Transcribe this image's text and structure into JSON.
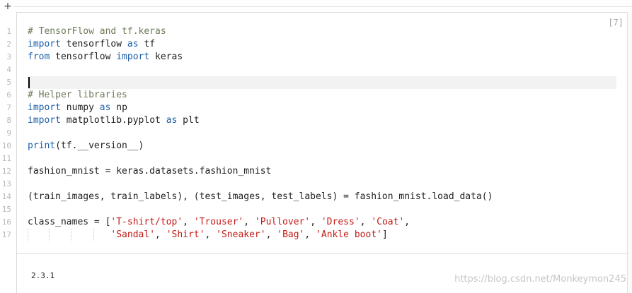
{
  "toolbar": {
    "add_cell_label": "+"
  },
  "cell": {
    "execution_count": "[7]",
    "line_numbers": [
      "1",
      "2",
      "3",
      "4",
      "5",
      "6",
      "7",
      "8",
      "9",
      "10",
      "11",
      "12",
      "13",
      "14",
      "15",
      "16",
      "17"
    ],
    "code_lines": [
      [
        {
          "t": "# TensorFlow and tf.keras",
          "c": "com"
        }
      ],
      [
        {
          "t": "import",
          "c": "kw"
        },
        {
          "t": " tensorflow "
        },
        {
          "t": "as",
          "c": "kw"
        },
        {
          "t": " tf"
        }
      ],
      [
        {
          "t": "from",
          "c": "kw"
        },
        {
          "t": " tensorflow "
        },
        {
          "t": "import",
          "c": "kw"
        },
        {
          "t": " keras"
        }
      ],
      [],
      [],
      [
        {
          "t": "# Helper libraries",
          "c": "com"
        }
      ],
      [
        {
          "t": "import",
          "c": "kw"
        },
        {
          "t": " numpy "
        },
        {
          "t": "as",
          "c": "kw"
        },
        {
          "t": " np"
        }
      ],
      [
        {
          "t": "import",
          "c": "kw"
        },
        {
          "t": " matplotlib.pyplot "
        },
        {
          "t": "as",
          "c": "kw"
        },
        {
          "t": " plt"
        }
      ],
      [],
      [
        {
          "t": "print",
          "c": "kw"
        },
        {
          "t": "(tf.__version__)"
        }
      ],
      [],
      [
        {
          "t": "fashion_mnist = keras.datasets.fashion_mnist"
        }
      ],
      [],
      [
        {
          "t": "(train_images, train_labels), (test_images, test_labels) = fashion_mnist.load_data()"
        }
      ],
      [],
      [
        {
          "t": "class_names = ["
        },
        {
          "t": "'T-shirt/top'",
          "c": "str"
        },
        {
          "t": ", "
        },
        {
          "t": "'Trouser'",
          "c": "str"
        },
        {
          "t": ", "
        },
        {
          "t": "'Pullover'",
          "c": "str"
        },
        {
          "t": ", "
        },
        {
          "t": "'Dress'",
          "c": "str"
        },
        {
          "t": ", "
        },
        {
          "t": "'Coat'",
          "c": "str"
        },
        {
          "t": ","
        }
      ],
      [
        {
          "t": "               "
        },
        {
          "t": "'Sandal'",
          "c": "str"
        },
        {
          "t": ", "
        },
        {
          "t": "'Shirt'",
          "c": "str"
        },
        {
          "t": ", "
        },
        {
          "t": "'Sneaker'",
          "c": "str"
        },
        {
          "t": ", "
        },
        {
          "t": "'Bag'",
          "c": "str"
        },
        {
          "t": ", "
        },
        {
          "t": "'Ankle boot'",
          "c": "str"
        },
        {
          "t": "]"
        }
      ]
    ],
    "active_line": 5,
    "output_text": "2.3.1"
  },
  "watermark": "https://blog.csdn.net/Monkeymon245"
}
